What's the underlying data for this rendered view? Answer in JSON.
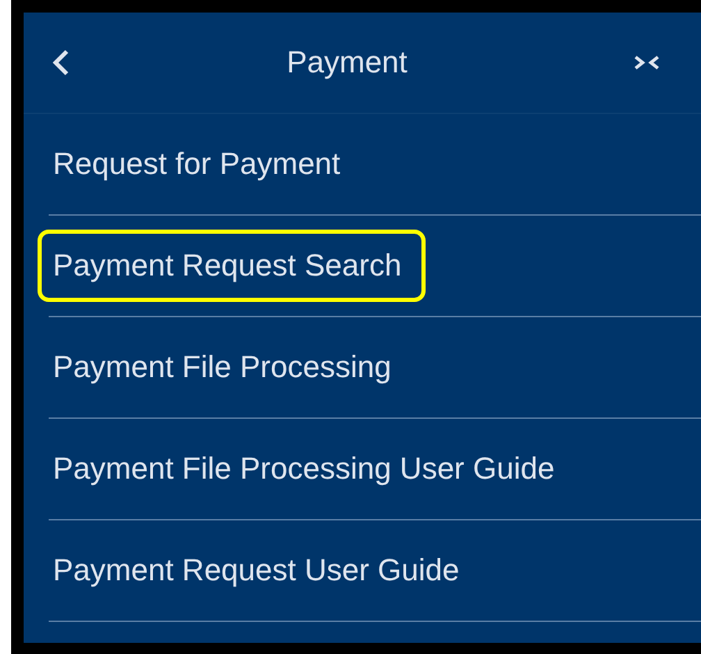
{
  "header": {
    "title": "Payment"
  },
  "menu_items": [
    {
      "label": "Request for Payment",
      "highlighted": false
    },
    {
      "label": "Payment Request Search",
      "highlighted": true
    },
    {
      "label": "Payment File Processing",
      "highlighted": false
    },
    {
      "label": "Payment File Processing User Guide",
      "highlighted": false
    },
    {
      "label": "Payment Request User Guide",
      "highlighted": false
    }
  ]
}
